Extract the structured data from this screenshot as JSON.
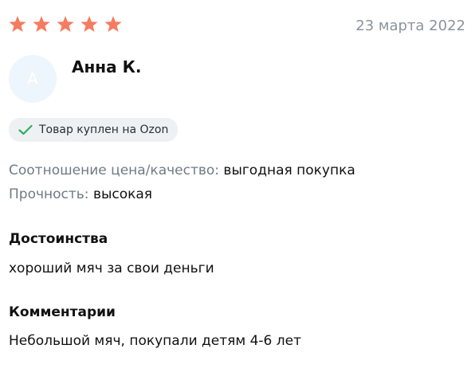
{
  "rating": {
    "value": 5,
    "max": 5,
    "star_color": "#f57c61"
  },
  "review": {
    "date": "23 марта 2022",
    "author": {
      "name": "Анна К.",
      "avatar_letter": "А",
      "avatar_bg": "#edf5fd"
    },
    "badge": {
      "icon": "check-icon",
      "label": "Товар куплен на Ozon",
      "check_color": "#2fae5b"
    },
    "params": [
      {
        "label": "Соотношение цена/качество:",
        "value": "выгодная покупка"
      },
      {
        "label": "Прочность:",
        "value": "высокая"
      }
    ],
    "sections": [
      {
        "title": "Достоинства",
        "text": "хороший мяч за свои деньги"
      },
      {
        "title": "Комментарии",
        "text": "Небольшой мяч, покупали детям 4-6 лет"
      }
    ]
  }
}
